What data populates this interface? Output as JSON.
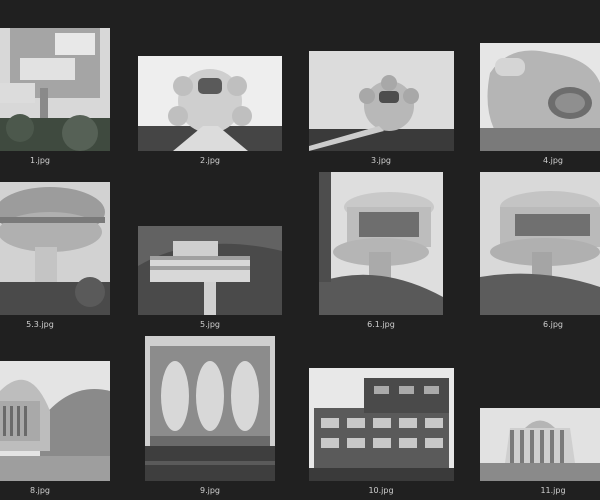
{
  "files": [
    {
      "name": "1.jpg"
    },
    {
      "name": "2.jpg"
    },
    {
      "name": "3.jpg"
    },
    {
      "name": "4.jpg"
    },
    {
      "name": "5.3.jpg"
    },
    {
      "name": "5.jpg"
    },
    {
      "name": "6.1.jpg"
    },
    {
      "name": "6.jpg"
    },
    {
      "name": "8.jpg"
    },
    {
      "name": "9.jpg"
    },
    {
      "name": "10.jpg"
    },
    {
      "name": "11.jpg"
    }
  ]
}
